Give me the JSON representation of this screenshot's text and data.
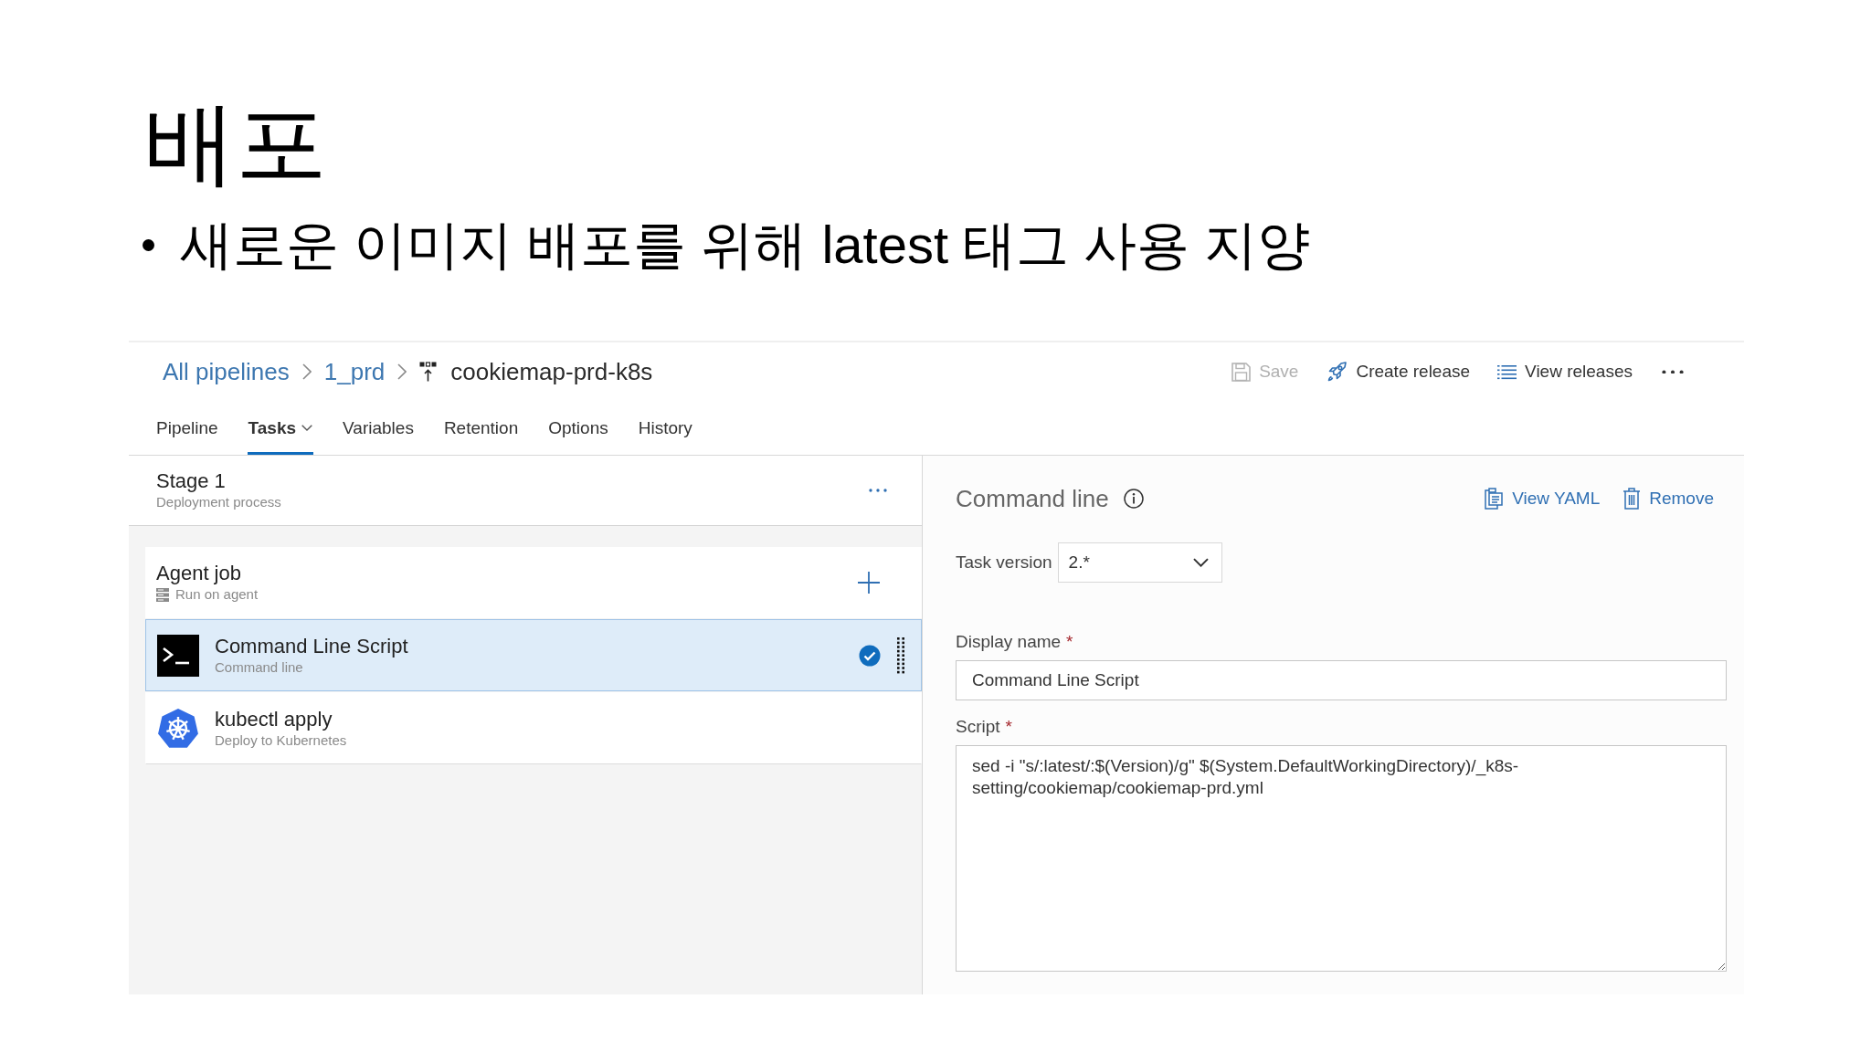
{
  "slide": {
    "title": "배포",
    "bullets": [
      "새로운 이미지 배포를 위해 latest 태그 사용 지양"
    ]
  },
  "header": {
    "breadcrumb": [
      "All pipelines",
      "1_prd"
    ],
    "pipeline_name": "cookiemap-prd-k8s",
    "actions": [
      {
        "kind": "save",
        "label": "Save",
        "disabled": true
      },
      {
        "kind": "release",
        "label": "Create release",
        "disabled": false
      },
      {
        "kind": "list",
        "label": "View releases",
        "disabled": false
      }
    ]
  },
  "tabs": [
    {
      "label": "Pipeline",
      "selected": false,
      "menu": false
    },
    {
      "label": "Tasks",
      "selected": true,
      "menu": true
    },
    {
      "label": "Variables",
      "selected": false,
      "menu": false
    },
    {
      "label": "Retention",
      "selected": false,
      "menu": false
    },
    {
      "label": "Options",
      "selected": false,
      "menu": false
    },
    {
      "label": "History",
      "selected": false,
      "menu": false
    }
  ],
  "stage": {
    "title": "Stage 1",
    "subtitle": "Deployment process"
  },
  "agent_job": {
    "title": "Agent job",
    "subtitle": "Run on agent"
  },
  "tasks": [
    {
      "kind": "command",
      "title": "Command Line Script",
      "subtitle": "Command line",
      "selected": true
    },
    {
      "kind": "kubernetes",
      "title": "kubectl apply",
      "subtitle": "Deploy to Kubernetes",
      "selected": false
    }
  ],
  "details": {
    "title": "Command line",
    "actions": [
      {
        "kind": "yaml",
        "label": "View YAML"
      },
      {
        "kind": "remove",
        "label": "Remove"
      }
    ],
    "task_version": {
      "label": "Task version",
      "value": "2.*"
    },
    "fields": [
      {
        "kind": "input",
        "label": "Display name",
        "required_mark": "*",
        "value": "Command Line Script"
      },
      {
        "kind": "textarea",
        "label": "Script",
        "required_mark": "*",
        "value": "sed -i \"s/:latest/:$(Version)/g\" $(System.DefaultWorkingDirectory)/_k8s-setting/cookiemap/cookiemap-prd.yml"
      }
    ]
  }
}
